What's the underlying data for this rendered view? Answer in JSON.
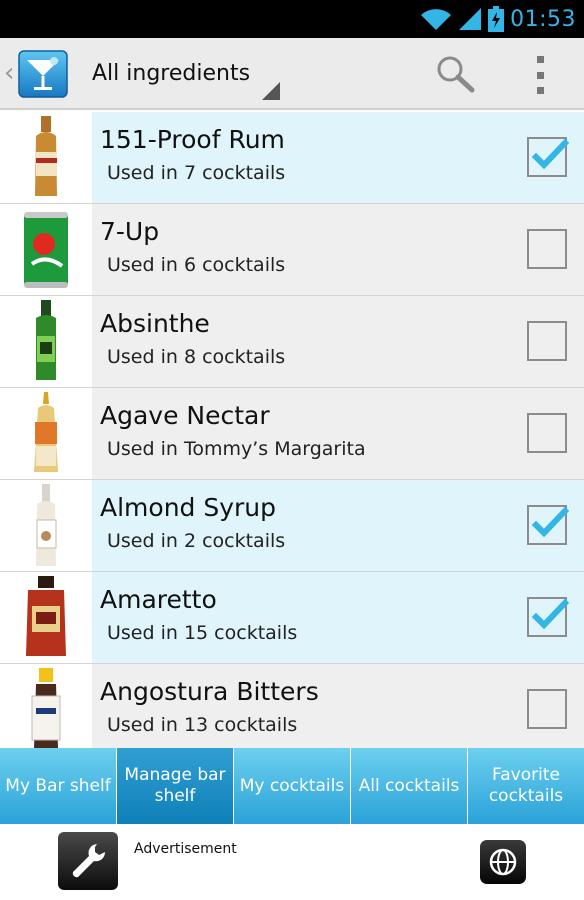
{
  "status_bar": {
    "time": "01:53"
  },
  "action_bar": {
    "filter_label": "All ingredients"
  },
  "ingredients": [
    {
      "name": "151-Proof Rum",
      "usage": "Used in 7 cocktails",
      "checked": true
    },
    {
      "name": "7-Up",
      "usage": "Used in 6 cocktails",
      "checked": false
    },
    {
      "name": "Absinthe",
      "usage": "Used in 8 cocktails",
      "checked": false
    },
    {
      "name": "Agave Nectar",
      "usage": "Used in Tommy’s Margarita",
      "checked": false
    },
    {
      "name": "Almond Syrup",
      "usage": "Used in 2 cocktails",
      "checked": true
    },
    {
      "name": "Amaretto",
      "usage": "Used in 15 cocktails",
      "checked": true
    },
    {
      "name": "Angostura Bitters",
      "usage": "Used in 13 cocktails",
      "checked": false
    }
  ],
  "tabs": [
    {
      "label": "My Bar shelf",
      "active": false
    },
    {
      "label": "Manage bar shelf",
      "active": true
    },
    {
      "label": "My cocktails",
      "active": false
    },
    {
      "label": "All cocktails",
      "active": false
    },
    {
      "label": "Favorite cocktails",
      "active": false
    }
  ],
  "ad": {
    "label": "Advertisement"
  },
  "colors": {
    "accent": "#33b5e5",
    "checked_row": "#dff5fb",
    "tab_bg": "#2aa2d8"
  },
  "icons": {
    "status": [
      "wifi-icon",
      "signal-icon",
      "battery-icon"
    ],
    "action": [
      "cocktail-glass-icon",
      "search-icon",
      "overflow-menu-icon"
    ],
    "ad": [
      "wrench-icon",
      "globe-icon"
    ]
  }
}
